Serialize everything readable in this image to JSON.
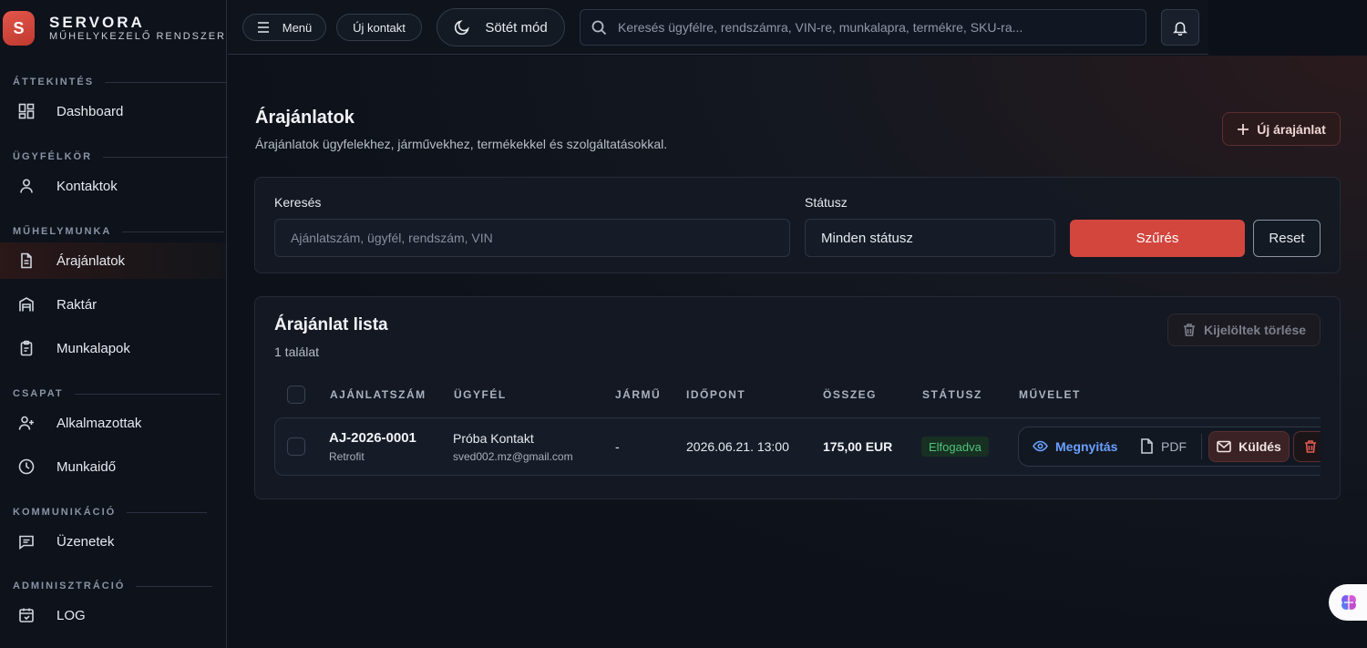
{
  "brand": {
    "logo_letter": "S",
    "name": "SERVORA",
    "subtitle": "MŰHELYKEZELŐ RENDSZER"
  },
  "sidebar": {
    "sections": [
      {
        "label": "ÁTTEKINTÉS"
      },
      {
        "label": "ÜGYFÉLKÖR"
      },
      {
        "label": "MŰHELYMUNKA"
      },
      {
        "label": "CSAPAT"
      },
      {
        "label": "KOMMUNIKÁCIÓ"
      },
      {
        "label": "ADMINISZTRÁCIÓ"
      }
    ],
    "items": [
      {
        "label": "Dashboard",
        "icon": "dashboard-icon"
      },
      {
        "label": "Kontaktok",
        "icon": "user-icon"
      },
      {
        "label": "Árajánlatok",
        "icon": "document-icon",
        "active": true
      },
      {
        "label": "Raktár",
        "icon": "warehouse-icon"
      },
      {
        "label": "Munkalapok",
        "icon": "clipboard-icon"
      },
      {
        "label": "Alkalmazottak",
        "icon": "user-plus-icon"
      },
      {
        "label": "Munkaidő",
        "icon": "clock-icon"
      },
      {
        "label": "Üzenetek",
        "icon": "message-icon"
      },
      {
        "label": "LOG",
        "icon": "calendar-icon"
      }
    ]
  },
  "topbar": {
    "menu_label": "Menü",
    "new_contact_label": "Új kontakt",
    "dark_mode_label": "Sötét mód",
    "search_placeholder": "Keresés ügyfélre, rendszámra, VIN-re, munkalapra, termékre, SKU-ra..."
  },
  "page": {
    "title": "Árajánlatok",
    "subtitle": "Árajánlatok ügyfelekhez, járművekhez, termékekkel és szolgáltatásokkal.",
    "new_button": "Új árajánlat"
  },
  "filters": {
    "search_label": "Keresés",
    "search_placeholder": "Ajánlatszám, ügyfél, rendszám, VIN",
    "status_label": "Státusz",
    "status_value": "Minden státusz",
    "filter_button": "Szűrés",
    "reset_button": "Reset"
  },
  "list": {
    "title": "Árajánlat lista",
    "count": "1 találat",
    "delete_selected": "Kijelöltek törlése",
    "columns": [
      "AJÁNLATSZÁM",
      "ÜGYFÉL",
      "JÁRMŰ",
      "IDŐPONT",
      "ÖSSZEG",
      "STÁTUSZ",
      "MŰVELET"
    ],
    "rows": [
      {
        "number": "AJ-2026-0001",
        "number_sub": "Retrofit",
        "client": "Próba Kontakt",
        "client_email": "sved002.mz@gmail.com",
        "vehicle": "-",
        "date": "2026.06.21. 13:00",
        "amount": "175,00 EUR",
        "status": "Elfogadva",
        "actions": {
          "open": "Megnyitás",
          "pdf": "PDF",
          "send": "Küldés"
        }
      }
    ]
  },
  "colors": {
    "accent": "#d2463e",
    "status_ok": "#4fc37a",
    "link": "#6aa0ff"
  }
}
